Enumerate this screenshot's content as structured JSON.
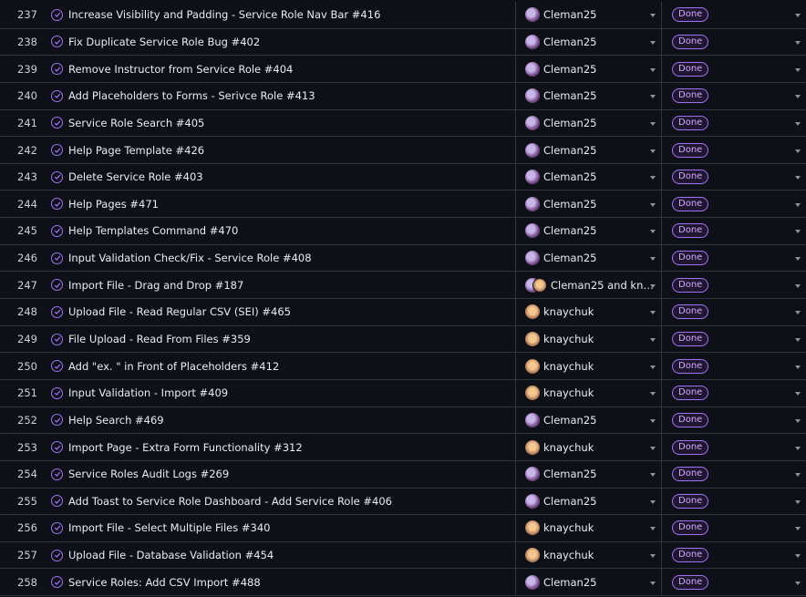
{
  "colors": {
    "accent": "#a371f7",
    "background": "#0d1117",
    "border": "#30363d"
  },
  "rows": [
    {
      "num": "237",
      "title": "Increase Visibility and Padding - Service Role Nav Bar  #416",
      "assignee": "Cleman25",
      "avatar": "cleman",
      "status": "Done"
    },
    {
      "num": "238",
      "title": "Fix Duplicate Service Role Bug  #402",
      "assignee": "Cleman25",
      "avatar": "cleman",
      "status": "Done"
    },
    {
      "num": "239",
      "title": "Remove Instructor from Service Role  #404",
      "assignee": "Cleman25",
      "avatar": "cleman",
      "status": "Done"
    },
    {
      "num": "240",
      "title": "Add Placeholders to Forms - Serivce Role  #413",
      "assignee": "Cleman25",
      "avatar": "cleman",
      "status": "Done"
    },
    {
      "num": "241",
      "title": "Service Role Search  #405",
      "assignee": "Cleman25",
      "avatar": "cleman",
      "status": "Done"
    },
    {
      "num": "242",
      "title": "Help Page Template  #426",
      "assignee": "Cleman25",
      "avatar": "cleman",
      "status": "Done"
    },
    {
      "num": "243",
      "title": "Delete Service Role  #403",
      "assignee": "Cleman25",
      "avatar": "cleman",
      "status": "Done"
    },
    {
      "num": "244",
      "title": "Help Pages  #471",
      "assignee": "Cleman25",
      "avatar": "cleman",
      "status": "Done"
    },
    {
      "num": "245",
      "title": "Help Templates Command  #470",
      "assignee": "Cleman25",
      "avatar": "cleman",
      "status": "Done"
    },
    {
      "num": "246",
      "title": "Input Validation Check/Fix - Service Role  #408",
      "assignee": "Cleman25",
      "avatar": "cleman",
      "status": "Done"
    },
    {
      "num": "247",
      "title": "Import File - Drag and Drop  #187",
      "assignee": "Cleman25 and kna…",
      "avatar": "both",
      "status": "Done"
    },
    {
      "num": "248",
      "title": "Upload File - Read Regular CSV (SEI)  #465",
      "assignee": "knaychuk",
      "avatar": "knaychuk",
      "status": "Done"
    },
    {
      "num": "249",
      "title": "File Upload - Read From Files  #359",
      "assignee": "knaychuk",
      "avatar": "knaychuk",
      "status": "Done"
    },
    {
      "num": "250",
      "title": "Add \"ex. \" in Front of Placeholders  #412",
      "assignee": "knaychuk",
      "avatar": "knaychuk",
      "status": "Done"
    },
    {
      "num": "251",
      "title": "Input Validation - Import  #409",
      "assignee": "knaychuk",
      "avatar": "knaychuk",
      "status": "Done"
    },
    {
      "num": "252",
      "title": "Help Search  #469",
      "assignee": "Cleman25",
      "avatar": "cleman",
      "status": "Done"
    },
    {
      "num": "253",
      "title": "Import Page - Extra Form Functionality  #312",
      "assignee": "knaychuk",
      "avatar": "knaychuk",
      "status": "Done"
    },
    {
      "num": "254",
      "title": "Service Roles Audit Logs  #269",
      "assignee": "Cleman25",
      "avatar": "cleman",
      "status": "Done"
    },
    {
      "num": "255",
      "title": "Add Toast to Service Role Dashboard - Add Service Role  #406",
      "assignee": "Cleman25",
      "avatar": "cleman",
      "status": "Done"
    },
    {
      "num": "256",
      "title": "Import File - Select Multiple Files  #340",
      "assignee": "knaychuk",
      "avatar": "knaychuk",
      "status": "Done"
    },
    {
      "num": "257",
      "title": "Upload File - Database Validation  #454",
      "assignee": "knaychuk",
      "avatar": "knaychuk",
      "status": "Done"
    },
    {
      "num": "258",
      "title": "Service Roles: Add CSV Import  #488",
      "assignee": "Cleman25",
      "avatar": "cleman",
      "status": "Done"
    }
  ]
}
